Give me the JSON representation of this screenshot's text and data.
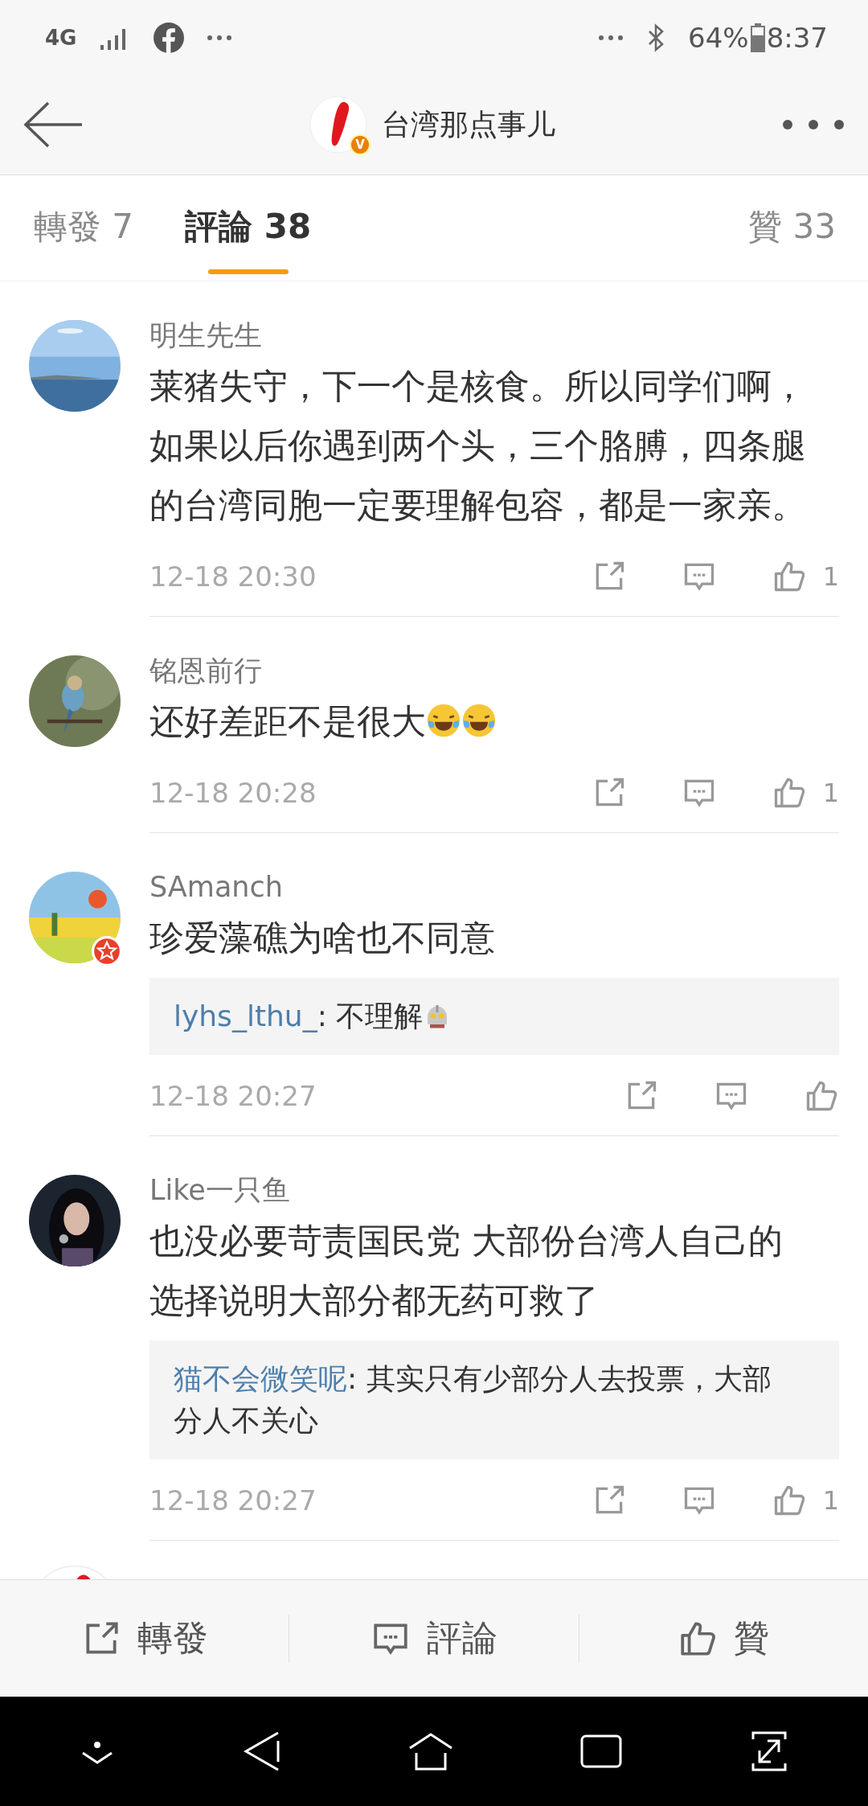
{
  "status_bar": {
    "network": "4G",
    "battery": "64%",
    "time": "8:37"
  },
  "header": {
    "title": "台湾那点事儿",
    "badge": "V"
  },
  "tabs": [
    {
      "label": "轉發 7",
      "selected": false
    },
    {
      "label": "評論 38",
      "selected": true
    },
    {
      "label": "贊 33",
      "selected": false
    }
  ],
  "comments": [
    {
      "name": "明生先生",
      "text": "莱猪失守，下一个是核食。所以同学们啊，如果以后你遇到两个头，三个胳膊，四条腿的台湾同胞一定要理解包容，都是一家亲。",
      "avatar_badge": false,
      "time": "12-18 20:30",
      "likes": "1"
    },
    {
      "name": "铭恩前行",
      "text": "还好差距不是很大",
      "emojis": [
        {
          "kind": "laughing"
        },
        {
          "kind": "laughing"
        }
      ],
      "avatar_badge": false,
      "time": "12-18 20:28",
      "likes": "1"
    },
    {
      "name": "SAmanch",
      "text": "珍爱藻礁为啥也不同意",
      "avatar_badge": true,
      "reply": {
        "user": "lyhs_lthu_",
        "text": ": 不理解",
        "emoji": {
          "kind": "robot"
        }
      },
      "time": "12-18 20:27"
    },
    {
      "name": "Like一只鱼",
      "text": "也没必要苛责国民党 大部份台湾人自己的选择说明大部分都无药可救了",
      "avatar_badge": false,
      "reply": {
        "user": "猫不会微笑呢",
        "text": ": 其实只有少部分人去投票，大部分人不关心"
      },
      "time": "12-18 20:27",
      "likes": "1"
    }
  ],
  "bottom_bar": [
    {
      "kind": "repost",
      "label": "轉發"
    },
    {
      "kind": "comment",
      "label": "評論"
    },
    {
      "kind": "like",
      "label": "贊"
    }
  ]
}
